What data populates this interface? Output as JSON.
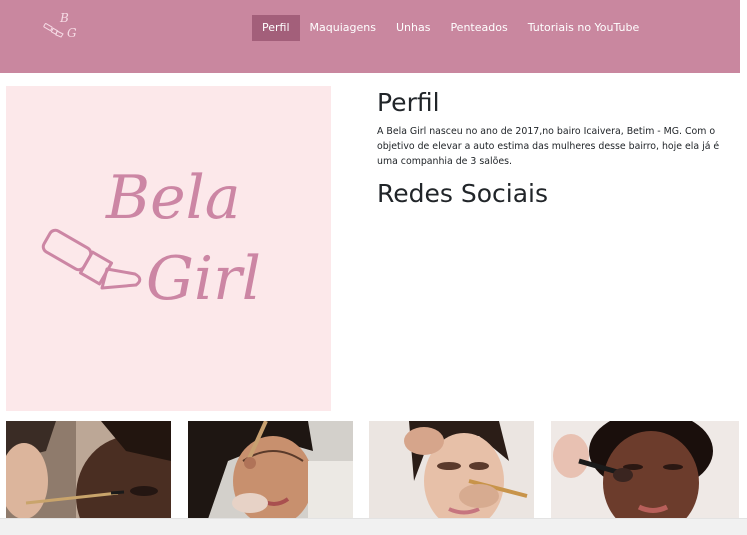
{
  "brand": {
    "logo_letters": [
      "B",
      "G"
    ]
  },
  "nav": {
    "items": [
      {
        "label": "Perfil",
        "active": true
      },
      {
        "label": "Maquiagens",
        "active": false
      },
      {
        "label": "Unhas",
        "active": false
      },
      {
        "label": "Penteados",
        "active": false
      },
      {
        "label": "Tutoriais no YouTube",
        "active": false
      }
    ]
  },
  "hero": {
    "logo_line1": "Bela",
    "logo_line2": "Girl"
  },
  "profile": {
    "title": "Perfil",
    "description": "A Bela Girl nasceu no ano de 2017,no bairo Icaivera, Betim - MG. Com o objetivo de elevar a auto estima das mulheres desse bairro, hoje ela já é uma companhia de 3 salões.",
    "social_title": "Redes Sociais"
  },
  "colors": {
    "navbar": "#c9879f",
    "nav_active": "#a35f7a",
    "hero_bg": "#fce8ea",
    "logo_pink": "#cc86a4"
  },
  "gallery": {
    "photos": [
      {
        "subject": "makeup-artist-applying-eyeliner"
      },
      {
        "subject": "woman-smiling-with-blush-brush"
      },
      {
        "subject": "eyeshadow-application-closeup"
      },
      {
        "subject": "woman-with-makeup-brush-on-cheek"
      }
    ]
  }
}
